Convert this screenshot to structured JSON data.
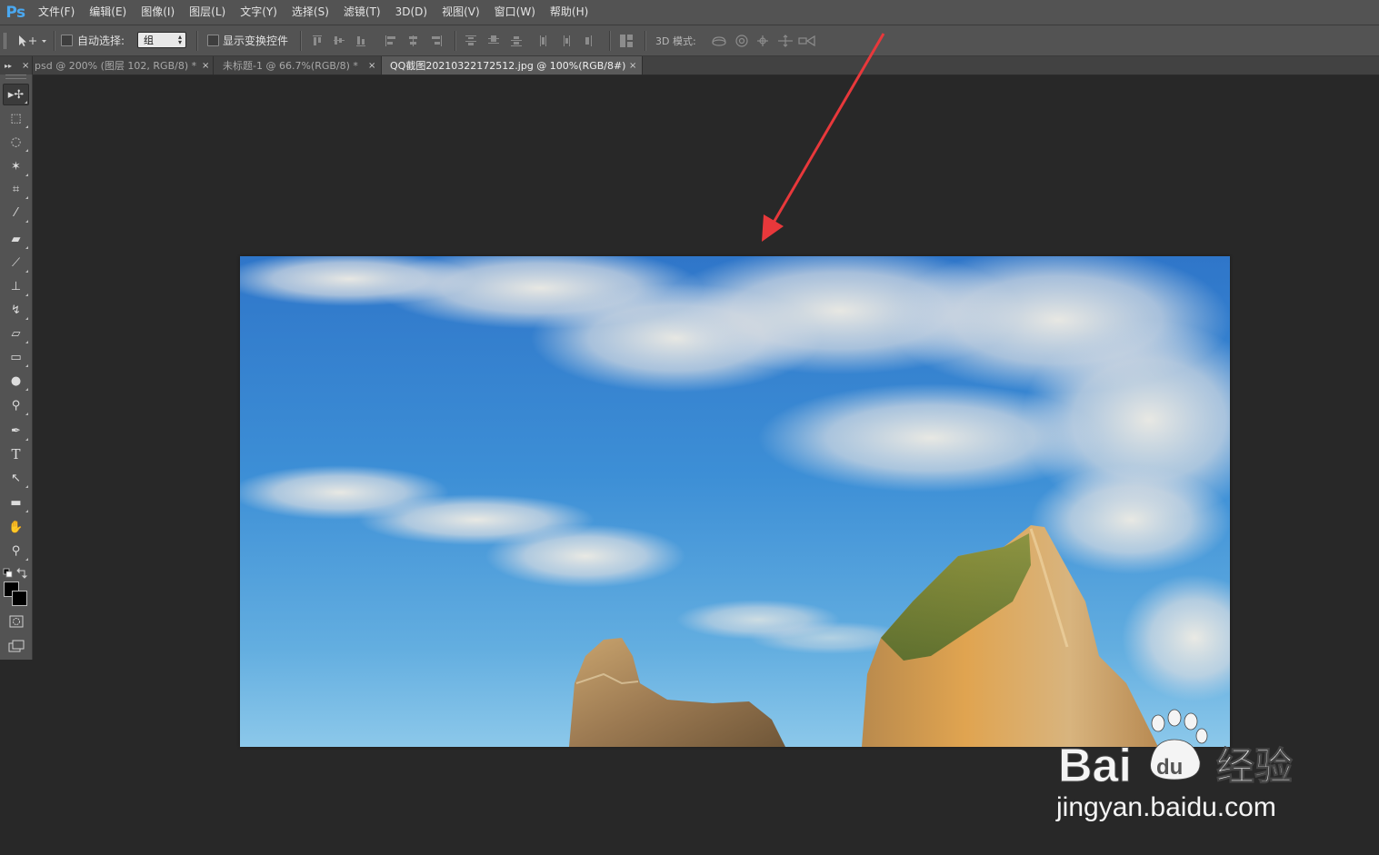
{
  "app": {
    "logo": "Ps"
  },
  "menu": [
    "文件(F)",
    "编辑(E)",
    "图像(I)",
    "图层(L)",
    "文字(Y)",
    "选择(S)",
    "滤镜(T)",
    "3D(D)",
    "视图(V)",
    "窗口(W)",
    "帮助(H)"
  ],
  "options": {
    "auto_select_label": "自动选择:",
    "auto_select_value": "组",
    "transform_label": "显示变换控件",
    "mode3d_label": "3D 模式:"
  },
  "tabs": [
    {
      "label": "psd @ 200% (图层 102, RGB/8) *",
      "active": false
    },
    {
      "label": "未标题-1 @ 66.7%(RGB/8) *",
      "active": false
    },
    {
      "label": "QQ截图20210322172512.jpg @ 100%(RGB/8#)",
      "active": true
    }
  ],
  "tab_close": "×",
  "tools": [
    {
      "name": "move-tool",
      "icon": "move-icon",
      "glyph": "▸✢"
    },
    {
      "name": "marquee-tool",
      "icon": "marquee-icon",
      "glyph": "⬚"
    },
    {
      "name": "lasso-tool",
      "icon": "lasso-icon",
      "glyph": "◌"
    },
    {
      "name": "magic-wand-tool",
      "icon": "magic-wand-icon",
      "glyph": "✶"
    },
    {
      "name": "crop-tool",
      "icon": "crop-icon",
      "glyph": "⌗"
    },
    {
      "name": "eyedropper-tool",
      "icon": "eyedropper-icon",
      "glyph": "⁄"
    },
    {
      "name": "healing-brush-tool",
      "icon": "bandage-icon",
      "glyph": "▰"
    },
    {
      "name": "brush-tool",
      "icon": "brush-icon",
      "glyph": "⟋"
    },
    {
      "name": "clone-stamp-tool",
      "icon": "stamp-icon",
      "glyph": "⊥"
    },
    {
      "name": "history-brush-tool",
      "icon": "history-brush-icon",
      "glyph": "↯"
    },
    {
      "name": "eraser-tool",
      "icon": "eraser-icon",
      "glyph": "▱"
    },
    {
      "name": "gradient-tool",
      "icon": "gradient-icon",
      "glyph": "▭"
    },
    {
      "name": "blur-tool",
      "icon": "drop-icon",
      "glyph": "●"
    },
    {
      "name": "dodge-tool",
      "icon": "dodge-icon",
      "glyph": "⚲"
    },
    {
      "name": "pen-tool",
      "icon": "pen-icon",
      "glyph": "✒"
    },
    {
      "name": "type-tool",
      "icon": "type-icon",
      "glyph": "T"
    },
    {
      "name": "path-selection-tool",
      "icon": "path-select-icon",
      "glyph": "↖"
    },
    {
      "name": "shape-tool",
      "icon": "rounded-rect-icon",
      "glyph": "▬"
    },
    {
      "name": "hand-tool",
      "icon": "hand-icon",
      "glyph": "✋"
    },
    {
      "name": "zoom-tool",
      "icon": "zoom-icon",
      "glyph": "⚲"
    }
  ],
  "colors": {
    "foreground": "#000000",
    "background": "#000000",
    "annotation_arrow": "#e8383b"
  },
  "watermark": {
    "brand": "Bai经验",
    "url": "jingyan.baidu.com"
  }
}
